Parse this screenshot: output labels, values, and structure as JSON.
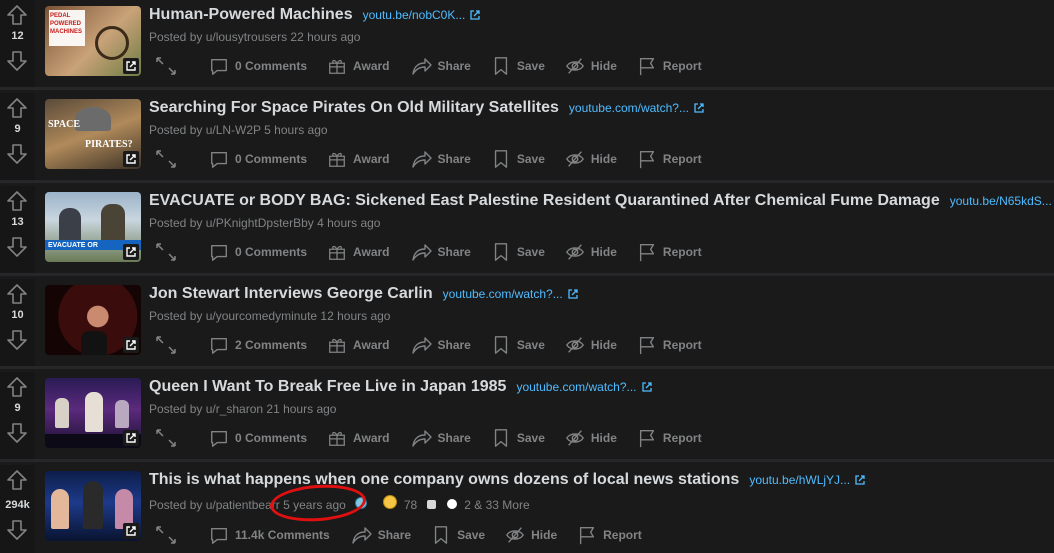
{
  "posts": [
    {
      "score": "12",
      "title": "Human-Powered Machines",
      "domain": "youtu.be/nobC0K...",
      "meta": "Posted by u/lousytrousers 22 hours ago",
      "comments": "0 Comments",
      "thumb_text": "PEDAL POWERED MACHINES"
    },
    {
      "score": "9",
      "title": "Searching For Space Pirates On Old Military Satellites",
      "domain": "youtube.com/watch?...",
      "meta": "Posted by u/LN-W2P 5 hours ago",
      "comments": "0 Comments",
      "thumb_text_1": "SPACE",
      "thumb_text_2": "PIRATES?"
    },
    {
      "score": "13",
      "title": "EVACUATE or BODY BAG: Sickened East Palestine Resident Quarantined After Chemical Fume Damage",
      "domain": "youtu.be/N65kdS...",
      "meta": "Posted by u/PKnightDpsterBby 4 hours ago",
      "comments": "0 Comments",
      "thumb_text": "EVACUATE OR"
    },
    {
      "score": "10",
      "title": "Jon Stewart Interviews George Carlin",
      "domain": "youtube.com/watch?...",
      "meta": "Posted by u/yourcomedyminute 12 hours ago",
      "comments": "2 Comments"
    },
    {
      "score": "9",
      "title": "Queen I Want To Break Free Live in Japan 1985",
      "domain": "youtube.com/watch?...",
      "meta": "Posted by u/r_sharon 21 hours ago",
      "comments": "0 Comments"
    },
    {
      "score": "294k",
      "title": "This is what happens when one company owns dozens of local news stations",
      "domain": "youtu.be/hWLjYJ...",
      "meta_user": "Posted by u/patientbearr",
      "meta_time": "5 years ago",
      "award_count": "78",
      "more_awards": "2 & 33 More",
      "comments": "11.4k Comments"
    }
  ],
  "labels": {
    "award": "Award",
    "share": "Share",
    "save": "Save",
    "hide": "Hide",
    "report": "Report"
  },
  "colors": {
    "background": "#1a1a1b",
    "link": "#4fbcff",
    "muted": "#818384",
    "annotation": "#e01010"
  }
}
